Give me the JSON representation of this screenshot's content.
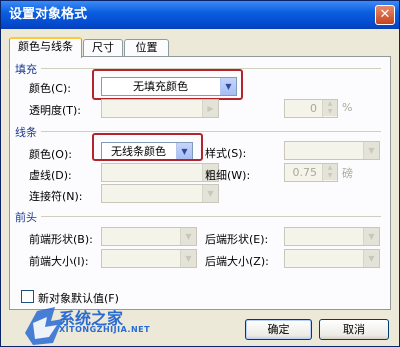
{
  "dialog": {
    "title": "设置对象格式",
    "close_glyph": "✕"
  },
  "tabs": [
    {
      "label": "颜色与线条",
      "active": true
    },
    {
      "label": "尺寸",
      "active": false
    },
    {
      "label": "位置",
      "active": false
    }
  ],
  "fill": {
    "section_label": "填充",
    "color_label": "颜色(C):",
    "color_value": "无填充颜色",
    "transparency_label": "透明度(T):",
    "transparency_value": "0",
    "transparency_unit": "%"
  },
  "line": {
    "section_label": "线条",
    "color_label": "颜色(O):",
    "color_value": "无线条颜色",
    "style_label": "样式(S):",
    "dash_label": "虚线(D):",
    "weight_label": "粗细(W):",
    "weight_value": "0.75",
    "weight_unit": "磅",
    "connector_label": "连接符(N):"
  },
  "arrows": {
    "section_label": "前头",
    "begin_style_label": "前端形状(B):",
    "end_style_label": "后端形状(E):",
    "begin_size_label": "前端大小(I):",
    "end_size_label": "后端大小(Z):"
  },
  "footer": {
    "default_checkbox_label": "新对象默认值(F)",
    "ok_label": "确定",
    "cancel_label": "取消"
  },
  "watermark": {
    "text": "系统之家",
    "url": "XITONGZHIJIA.NET"
  },
  "colors": {
    "title_bar": "#0a5fe0",
    "dialog_bg": "#ece9d8",
    "highlight": "#b3242c",
    "watermark": "#2a6bd3"
  }
}
